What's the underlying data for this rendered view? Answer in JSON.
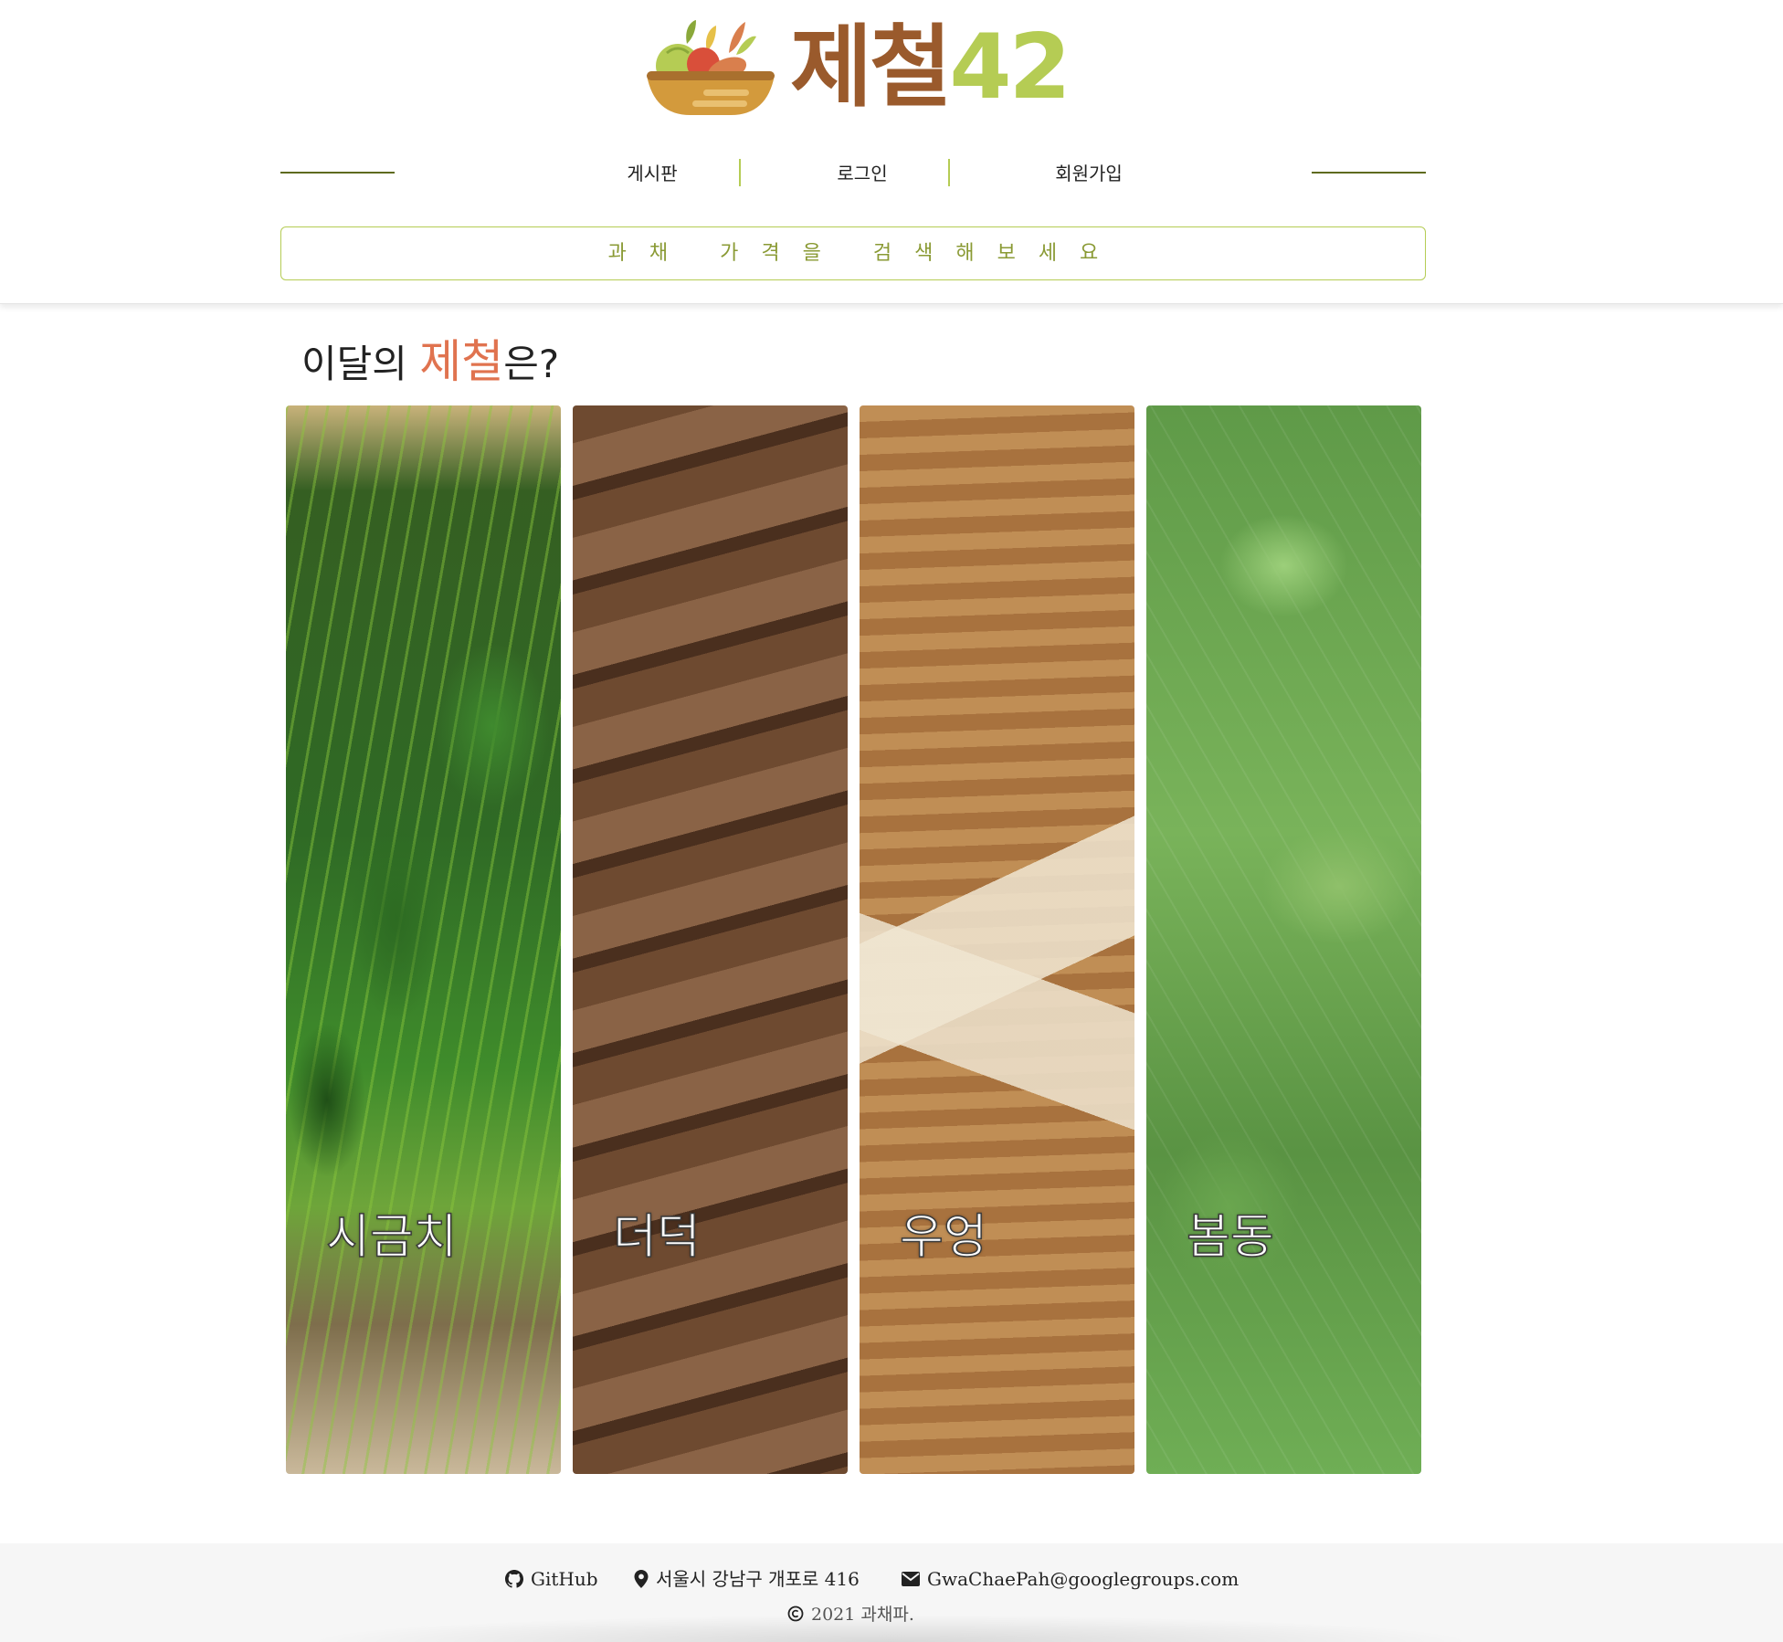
{
  "header": {
    "logo": {
      "word": "제철",
      "number": "42"
    },
    "nav": [
      {
        "label": "게시판"
      },
      {
        "label": "로그인"
      },
      {
        "label": "회원가입"
      }
    ],
    "search": {
      "placeholder": "과채 가격을 검색해보세요",
      "value": ""
    }
  },
  "main": {
    "title": {
      "prefix": "이달의 ",
      "accent": "제철",
      "suffix": "은?"
    },
    "cards": [
      {
        "label": "시금치",
        "image": "spinach"
      },
      {
        "label": "더덕",
        "image": "deodeok-roots"
      },
      {
        "label": "우엉",
        "image": "burdock-roots"
      },
      {
        "label": "봄동",
        "image": "bomdong-greens"
      }
    ]
  },
  "footer": {
    "github": "GitHub",
    "address": "서울시 강남구 개포로 416",
    "email": "GwaChaePah@googlegroups.com",
    "copyright": "2021 과채파."
  },
  "colors": {
    "brand_brown": "#9a5a2c",
    "brand_green": "#b5cc54",
    "accent_orange": "#e0734f",
    "nav_line": "#5e6b1e"
  }
}
